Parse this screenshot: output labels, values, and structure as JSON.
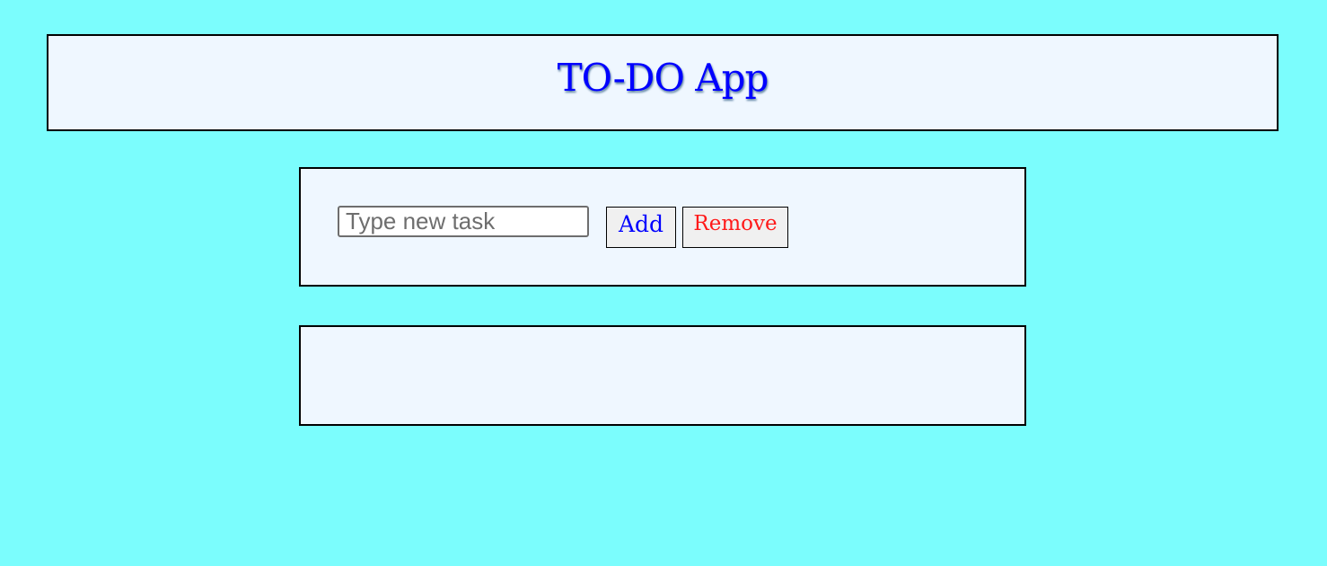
{
  "header": {
    "title": "TO-DO App"
  },
  "task_form": {
    "input_placeholder": "Type new task",
    "input_value": "",
    "add_label": "Add",
    "remove_label": "Remove"
  },
  "task_list": {
    "items": []
  },
  "colors": {
    "page_background": "#7bfdfd",
    "panel_background": "#eff7ff",
    "title_color": "#0000ff",
    "add_color": "#0000ff",
    "remove_color": "#ff1a1a"
  }
}
